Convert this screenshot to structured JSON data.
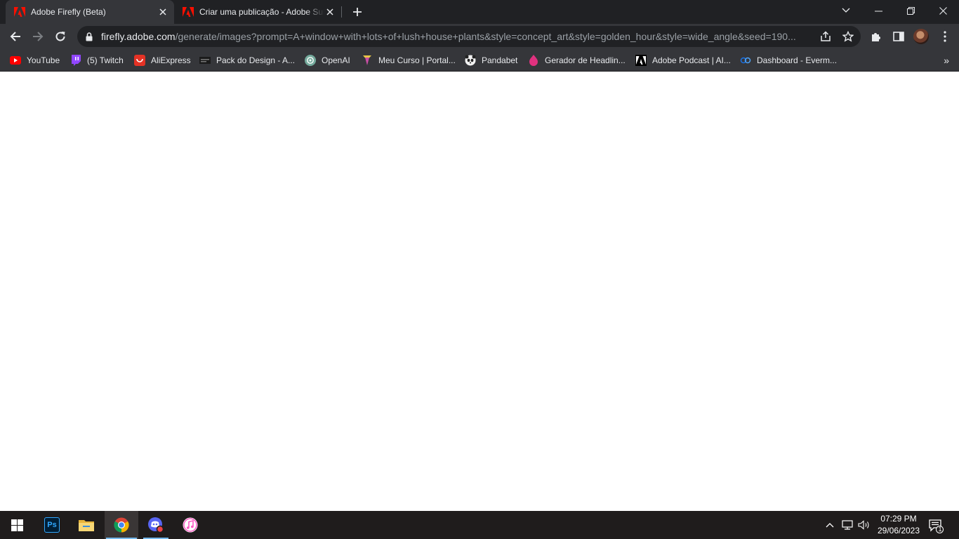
{
  "tabs": [
    {
      "title": "Adobe Firefly (Beta)",
      "active": true
    },
    {
      "title": "Criar uma publicação - Adobe Sul",
      "active": false
    }
  ],
  "address_bar": {
    "host": "firefly.adobe.com",
    "path": "/generate/images?prompt=A+window+with+lots+of+lush+house+plants&style=concept_art&style=golden_hour&style=wide_angle&seed=190..."
  },
  "bookmarks": [
    {
      "label": "YouTube",
      "icon": "youtube-icon"
    },
    {
      "label": "(5) Twitch",
      "icon": "twitch-icon"
    },
    {
      "label": "AliExpress",
      "icon": "aliexpress-icon"
    },
    {
      "label": "Pack do Design - A...",
      "icon": "pack-design-icon"
    },
    {
      "label": "OpenAI",
      "icon": "openai-icon"
    },
    {
      "label": "Meu Curso | Portal...",
      "icon": "meu-curso-icon"
    },
    {
      "label": "Pandabet",
      "icon": "pandabet-icon"
    },
    {
      "label": "Gerador de Headlin...",
      "icon": "gerador-icon"
    },
    {
      "label": "Adobe Podcast | AI...",
      "icon": "adobe-podcast-icon"
    },
    {
      "label": "Dashboard - Everm...",
      "icon": "dashboard-icon"
    }
  ],
  "bookmarks_overflow": "»",
  "taskbar": {
    "apps": [
      "windows-start-icon",
      "photoshop-icon",
      "file-explorer-icon",
      "chrome-icon",
      "discord-icon",
      "itunes-icon"
    ],
    "photoshop_label": "Ps",
    "time": "07:29 PM",
    "date": "29/06/2023",
    "notification_count": "1"
  },
  "colors": {
    "tab_bar": "#202124",
    "toolbar": "#35363a",
    "adobe_red": "#fa0f00",
    "taskbar": "#1f1c1c",
    "taskbar_accent": "#76b9ed"
  }
}
